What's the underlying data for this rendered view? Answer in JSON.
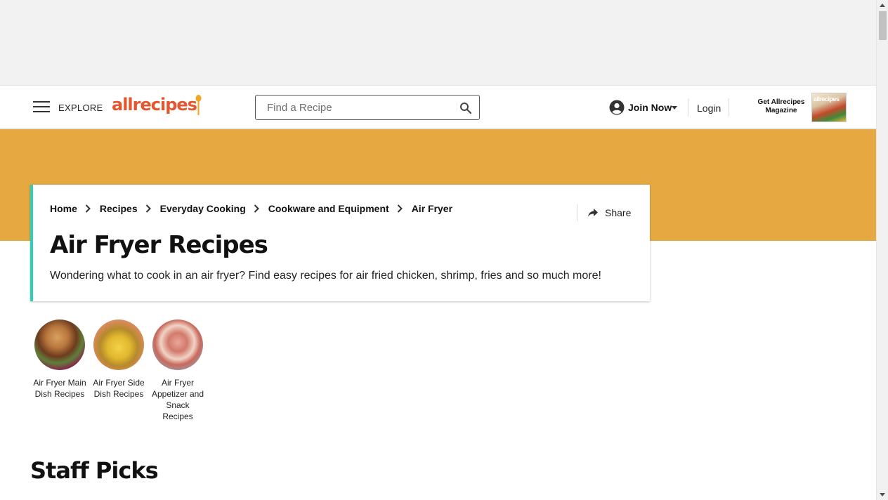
{
  "header": {
    "explore_label": "EXPLORE",
    "logo_text": "allrecipes",
    "search_placeholder": "Find a Recipe",
    "join_label": "Join Now",
    "login_label": "Login",
    "magazine_label": "Get Allrecipes Magazine",
    "magazine_cover_title": "allrecipes"
  },
  "breadcrumb": [
    "Home",
    "Recipes",
    "Everyday Cooking",
    "Cookware and Equipment",
    "Air Fryer"
  ],
  "share_label": "Share",
  "page": {
    "title": "Air Fryer Recipes",
    "description": "Wondering what to cook in an air fryer? Find easy recipes for air fried chicken, shrimp, fries and so much more!"
  },
  "categories": [
    {
      "label": "Air Fryer Main Dish Recipes"
    },
    {
      "label": "Air Fryer Side Dish Recipes"
    },
    {
      "label": "Air Fryer Appetizer and Snack Recipes"
    }
  ],
  "sections": {
    "staff_picks": "Staff Picks"
  },
  "colors": {
    "brand_orange": "#e4572e",
    "banner": "#e6a942",
    "accent_teal": "#2ecfb6"
  }
}
